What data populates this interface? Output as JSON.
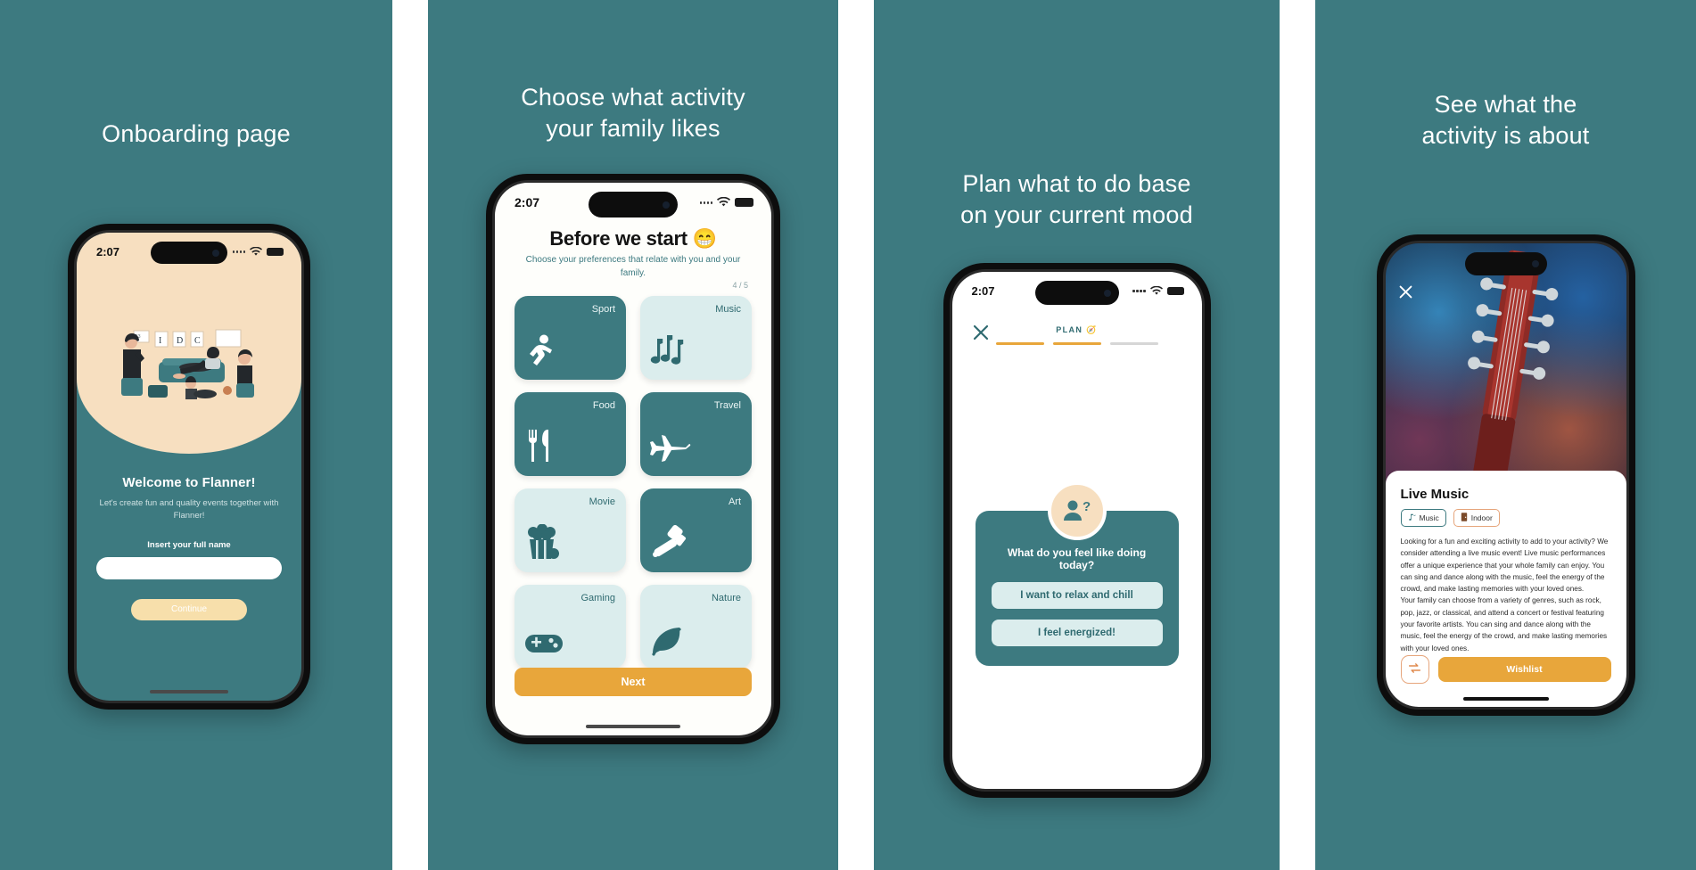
{
  "panels": [
    {
      "caption": "Onboarding page"
    },
    {
      "caption": "Choose what activity\nyour family likes"
    },
    {
      "caption": "Plan what to do base\non your current mood"
    },
    {
      "caption": "See what the\nactivity is about"
    }
  ],
  "status": {
    "time": "2:07"
  },
  "onboarding": {
    "title": "Welcome to Flanner!",
    "subtitle": "Let's create fun and quality events together with Flanner!",
    "field_label": "Insert your full name",
    "field_value": "",
    "field_placeholder": "",
    "button": "Continue"
  },
  "preferences": {
    "title": "Before we start",
    "title_emoji": "😁",
    "subtitle": "Choose your preferences that relate with you and your family.",
    "counter": "4 / 5",
    "categories": [
      {
        "label": "Sport",
        "icon": "running-icon",
        "selected": true
      },
      {
        "label": "Music",
        "icon": "music-note-icon",
        "selected": false
      },
      {
        "label": "Food",
        "icon": "cutlery-icon",
        "selected": true
      },
      {
        "label": "Travel",
        "icon": "airplane-icon",
        "selected": true
      },
      {
        "label": "Movie",
        "icon": "popcorn-icon",
        "selected": false
      },
      {
        "label": "Art",
        "icon": "paintbrush-icon",
        "selected": true
      },
      {
        "label": "Gaming",
        "icon": "gamepad-icon",
        "selected": false
      },
      {
        "label": "Nature",
        "icon": "leaf-icon",
        "selected": false
      }
    ],
    "next_button": "Next"
  },
  "plan": {
    "step_label": "PLAN",
    "step_emoji": "🧭",
    "progress": [
      "on",
      "on",
      "off"
    ],
    "question": "What do you feel like doing today?",
    "options": [
      "I want to relax and chill",
      "I feel energized!"
    ]
  },
  "activity": {
    "title": "Live Music",
    "tags": [
      {
        "label": "Music",
        "icon": "music-note-icon"
      },
      {
        "label": "Indoor",
        "icon": "door-icon"
      }
    ],
    "description_p1": "Looking for a fun and exciting activity to add to your activity? We consider attending a live music event! Live music performances offer a unique experience that your whole family can enjoy. You can sing and dance along with the music, feel the energy of the crowd, and make lasting memories with your loved ones.",
    "description_p2": "Your family can choose from a variety of genres, such as rock, pop, jazz, or classical, and attend a concert or festival featuring your favorite artists. You can sing and dance along with the music, feel the energy of the crowd, and make lasting memories with your loved ones.",
    "refresh_action": "shuffle-icon",
    "wishlist_button": "Wishlist"
  },
  "colors": {
    "teal": "#3D7A80",
    "mint": "#DBEDED",
    "orange": "#E8A63B",
    "peach": "#F7DFC0",
    "cream_button": "#F7DFAB"
  }
}
